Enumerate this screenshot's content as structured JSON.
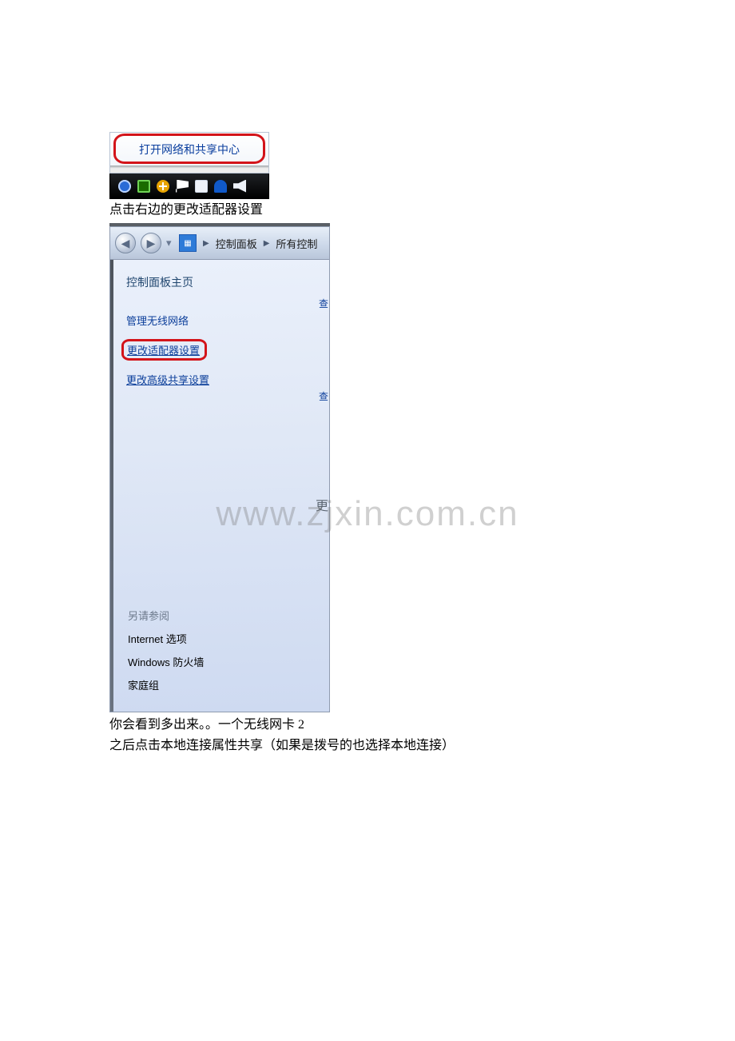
{
  "tray": {
    "open_network_label": "打开网络和共享中心",
    "icons": [
      "globe-icon",
      "shield-icon",
      "plus-icon",
      "flag-icon",
      "pc-icon",
      "person-icon",
      "volume-icon"
    ]
  },
  "text": {
    "line1": "点击右边的更改适配器设置",
    "line2": "你会看到多出来。。一个无线网卡 2",
    "line3": "之后点击本地连接属性共享（如果是拨号的也选择本地连接）"
  },
  "cp": {
    "breadcrumb": {
      "control_panel": "控制面板",
      "all": "所有控制"
    },
    "sidebar": {
      "home": "控制面板主页",
      "manage_wireless": "管理无线网络",
      "change_adapter": "更改适配器设置",
      "change_sharing": "更改高级共享设置"
    },
    "see_also": {
      "title": "另请参阅",
      "internet": "Internet 选项",
      "firewall": "Windows 防火墙",
      "homegroup": "家庭组"
    },
    "edge": {
      "f1": "查",
      "f2": "查",
      "f3": "更"
    }
  },
  "watermark": "www.zjxin.com.cn"
}
